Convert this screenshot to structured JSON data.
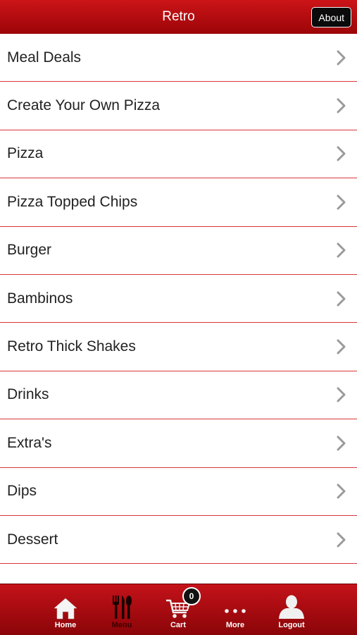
{
  "header": {
    "title": "Retro",
    "about_label": "About"
  },
  "menu_items": [
    {
      "label": "Meal Deals"
    },
    {
      "label": "Create Your Own Pizza"
    },
    {
      "label": "Pizza"
    },
    {
      "label": "Pizza Topped Chips"
    },
    {
      "label": "Burger"
    },
    {
      "label": "Bambinos"
    },
    {
      "label": "Retro Thick Shakes"
    },
    {
      "label": "Drinks"
    },
    {
      "label": "Extra's"
    },
    {
      "label": "Dips"
    },
    {
      "label": "Dessert"
    }
  ],
  "tabbar": {
    "home": {
      "label": "Home",
      "icon": "home-icon"
    },
    "menu": {
      "label": "Menu",
      "icon": "cutlery-icon"
    },
    "cart": {
      "label": "Cart",
      "icon": "cart-icon",
      "badge": "0"
    },
    "more": {
      "label": "More",
      "icon": "more-dots-icon"
    },
    "logout": {
      "label": "Logout",
      "icon": "user-icon"
    }
  },
  "colors": {
    "brand_red": "#b20a0e",
    "divider": "#d9363a",
    "chevron": "#9a9a9a"
  }
}
